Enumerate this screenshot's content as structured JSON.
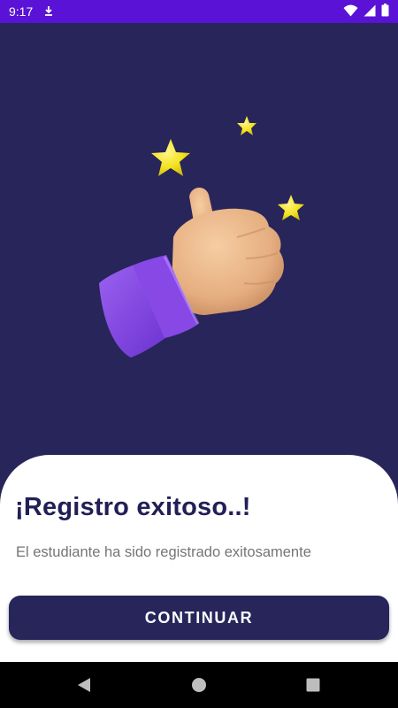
{
  "status_bar": {
    "time": "9:17",
    "background": "#5a12d6",
    "icons": [
      "download-notification-icon",
      "wifi-icon",
      "cell-signal-icon",
      "battery-icon"
    ]
  },
  "hero": {
    "illustration": "thumbs-up-with-stars",
    "background": "#27255a"
  },
  "dialog": {
    "title": "¡Registro exitoso..!",
    "message": "El estudiante ha sido registrado exitosamente",
    "button_label": "CONTINUAR",
    "accent": "#27255a"
  },
  "nav_bar": {
    "icons": [
      "back-icon",
      "home-icon",
      "recents-icon"
    ]
  }
}
